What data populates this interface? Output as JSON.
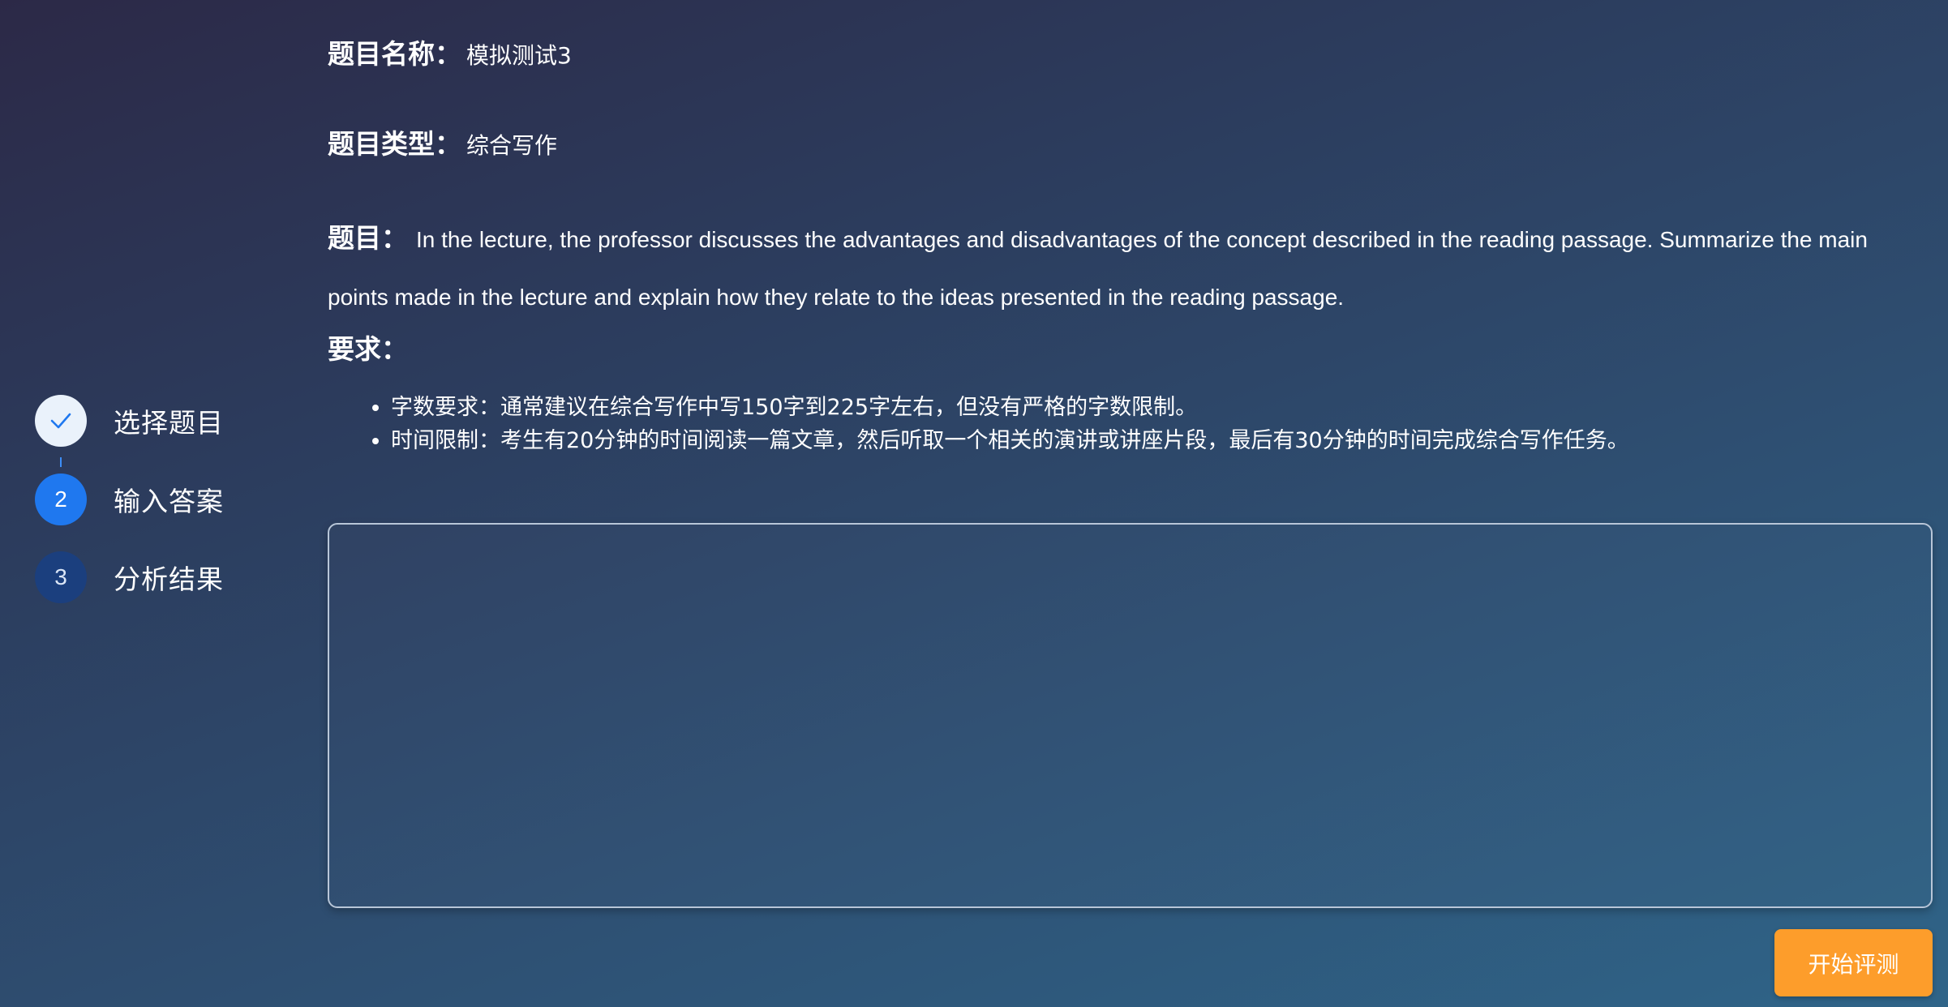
{
  "steps": [
    {
      "label": "选择题目",
      "status": "done",
      "icon": "check-icon"
    },
    {
      "label": "输入答案",
      "status": "active",
      "number": "2"
    },
    {
      "label": "分析结果",
      "status": "pending",
      "number": "3"
    }
  ],
  "topic": {
    "name_key": "题目名称：",
    "name_value": "模拟测试3",
    "type_key": "题目类型：",
    "type_value": "综合写作",
    "question_key": "题目：",
    "question_text": "In the lecture, the professor discusses the advantages and disadvantages of the concept described in the reading passage. Summarize the main points made in the lecture and explain how they relate to the ideas presented in the reading passage."
  },
  "requirements": {
    "title": "要求：",
    "items": [
      "字数要求：通常建议在综合写作中写150字到225字左右，但没有严格的字数限制。",
      "时间限制：考生有20分钟的时间阅读一篇文章，然后听取一个相关的演讲或讲座片段，最后有30分钟的时间完成综合写作任务。"
    ]
  },
  "answer": {
    "value": "",
    "placeholder": ""
  },
  "actions": {
    "submit_label": "开始评测"
  },
  "colors": {
    "accent": "#1f78ef",
    "step_pending": "#1b3f7e",
    "button": "#fd9d2b"
  }
}
